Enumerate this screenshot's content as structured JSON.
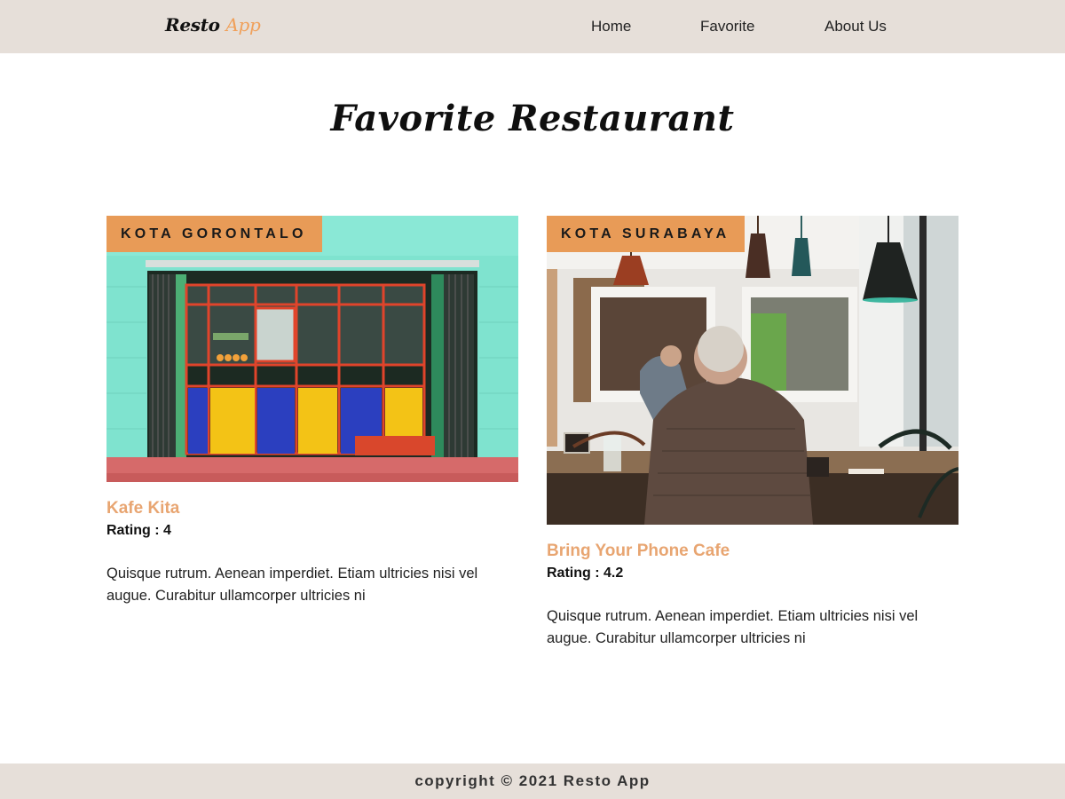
{
  "navbar": {
    "brand_part1": "Resto",
    "brand_part2": "App",
    "links": [
      "Home",
      "Favorite",
      "About Us"
    ]
  },
  "page": {
    "title": "Favorite Restaurant"
  },
  "restaurants": [
    {
      "city": "KOTA GORONTALO",
      "name": "Kafe Kita",
      "rating_label": "Rating : ",
      "rating": "4",
      "description": "Quisque rutrum. Aenean imperdiet. Etiam ultricies nisi vel augue. Curabitur ullamcorper ultricies ni"
    },
    {
      "city": "KOTA SURABAYA",
      "name": "Bring Your Phone Cafe",
      "rating_label": "Rating : ",
      "rating": "4.2",
      "description": "Quisque rutrum. Aenean imperdiet. Etiam ultricies nisi vel augue. Curabitur ullamcorper ultricies ni"
    }
  ],
  "footer": {
    "text": "copyright © 2021 Resto App"
  },
  "colors": {
    "nav_background": "#e6dfd9",
    "accent": "#e89b57",
    "title_accent": "#e8a571"
  }
}
